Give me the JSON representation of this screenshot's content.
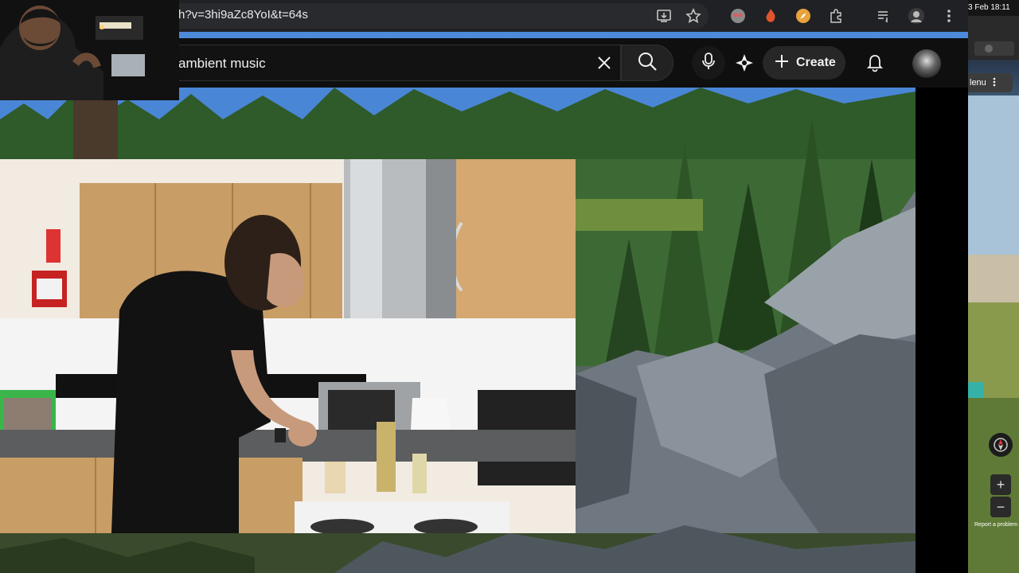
{
  "browser": {
    "url_visible": "h?v=3hi9aZc8YoI&t=64s",
    "icons": [
      "install-icon",
      "bookmark-star-icon",
      "extension-avatar-icon",
      "extension-flame-icon",
      "extension-compass-icon",
      "extensions-puzzle-icon",
      "media-queue-icon",
      "profile-icon",
      "more-vert-icon"
    ]
  },
  "youtube": {
    "search_value": "ambient music",
    "create_label": "Create",
    "icons": [
      "clear-icon",
      "search-icon",
      "mic-icon",
      "gemini-icon",
      "plus-icon",
      "bell-icon",
      "avatar"
    ]
  },
  "side_window": {
    "clock": "3 Feb  18:11",
    "menu_label": "lenu",
    "report_label": "Report a problem",
    "zoom_in": "+",
    "zoom_out": "−"
  },
  "colors": {
    "chrome_bg": "#202124",
    "yt_bg": "#0f0f0f",
    "button_bg": "#272727"
  }
}
